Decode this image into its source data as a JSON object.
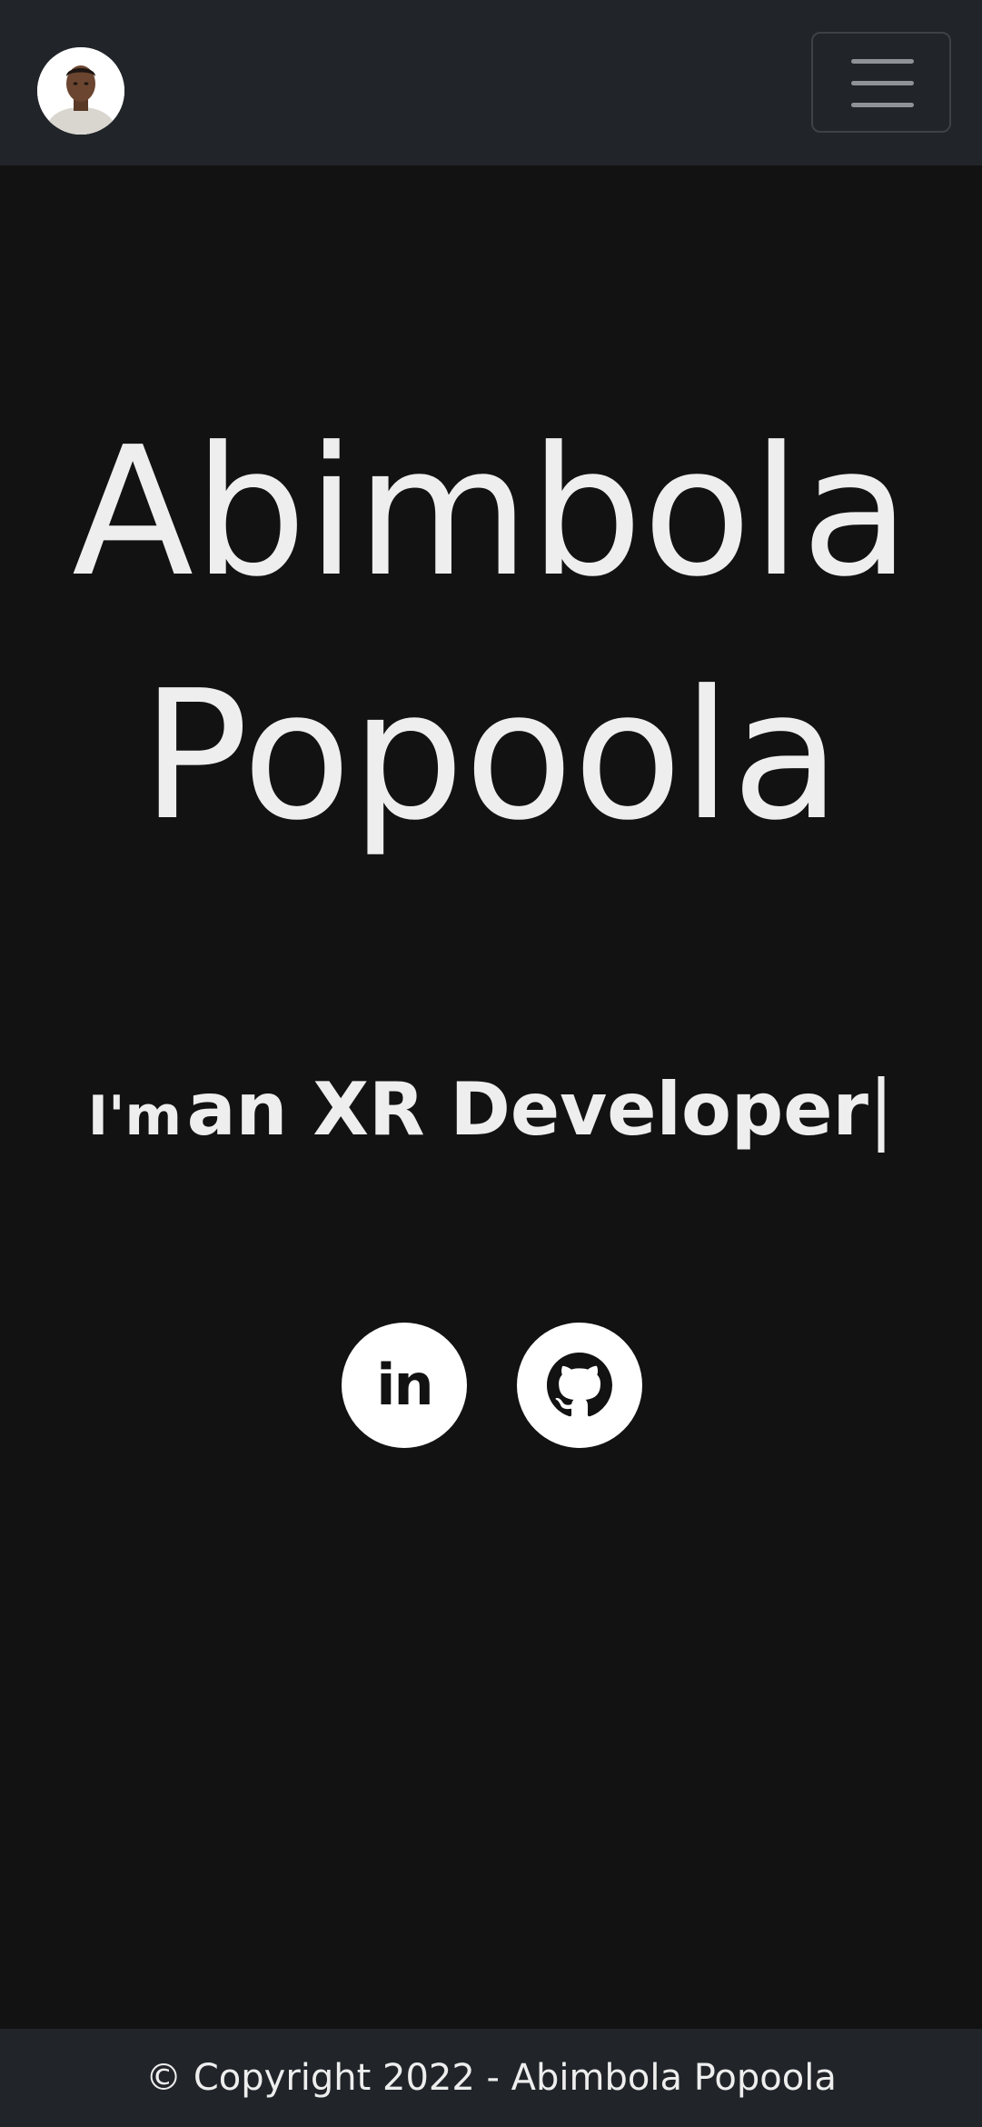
{
  "navbar": {
    "avatar_alt": "Abimbola Popoola",
    "toggler_icon": "hamburger-menu-icon"
  },
  "hero": {
    "name": "Abimbola Popoola",
    "tagline_prefix": "I'm",
    "tagline_role": "an XR Developer",
    "cursor": "|"
  },
  "social": {
    "linkedin_label": "in",
    "linkedin_icon": "linkedin-icon",
    "github_icon": "github-icon"
  },
  "footer": {
    "copyright": "© Copyright 2022 - Abimbola Popoola"
  },
  "colors": {
    "navbar_bg": "#212529",
    "page_bg": "#121212",
    "text": "#eeeeee"
  }
}
